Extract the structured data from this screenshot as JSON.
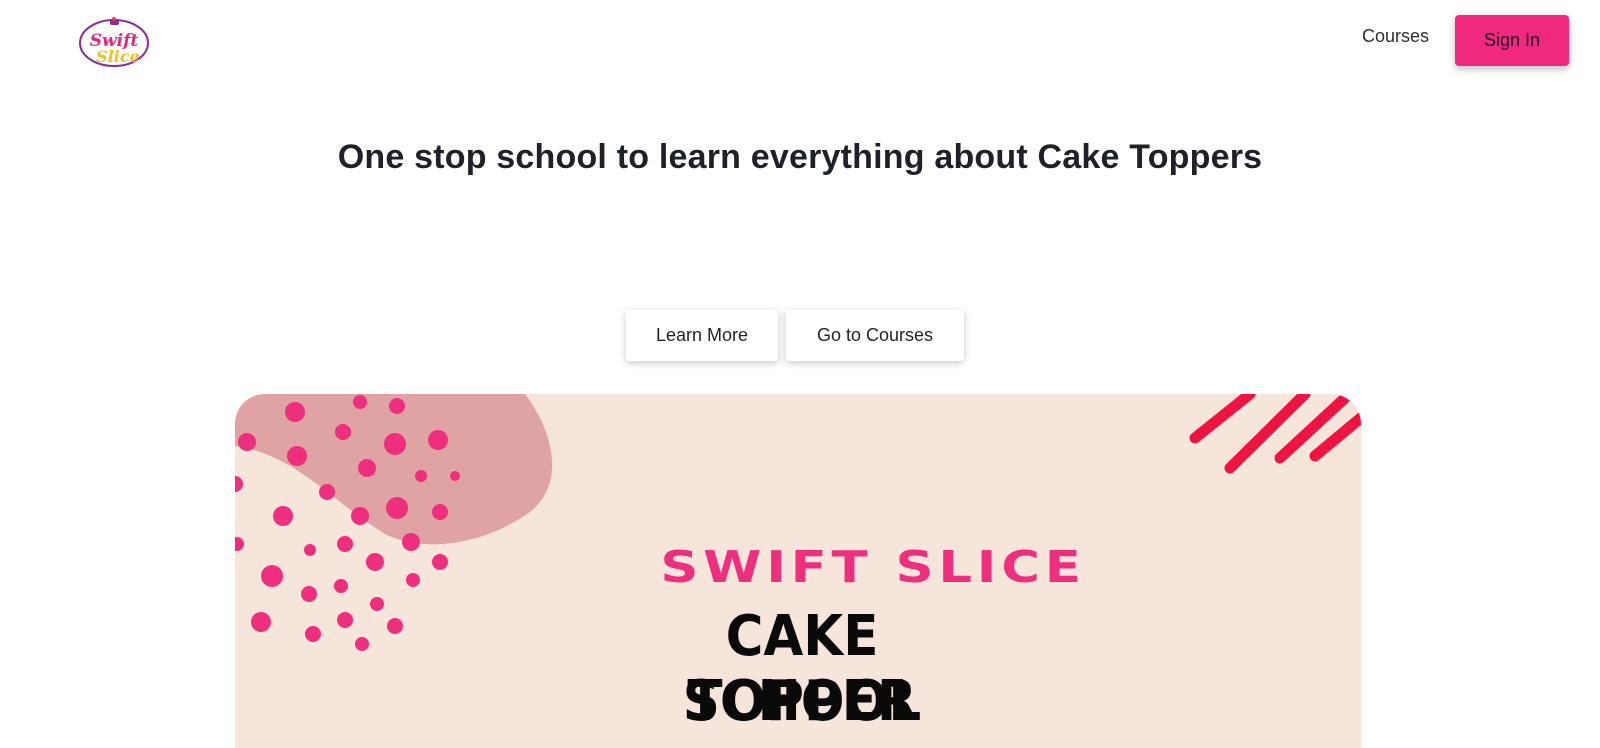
{
  "header": {
    "logo_text_line1": "Swift",
    "logo_text_line2": "Slice",
    "nav_courses": "Courses",
    "signin_label": "Sign In"
  },
  "hero": {
    "title": "One stop school to learn everything about Cake Toppers",
    "learn_more": "Learn More",
    "go_to_courses": "Go to Courses"
  },
  "banner": {
    "brand": "SWIFT SLICE",
    "line1": "CAKE TOPPER",
    "line2": "SCHOOL"
  },
  "colors": {
    "accent": "#f0287f",
    "banner_bg": "#f5e5db",
    "blob": "#e0a3a3",
    "dots": "#ee2f7e",
    "strokes": "#ee1340"
  }
}
